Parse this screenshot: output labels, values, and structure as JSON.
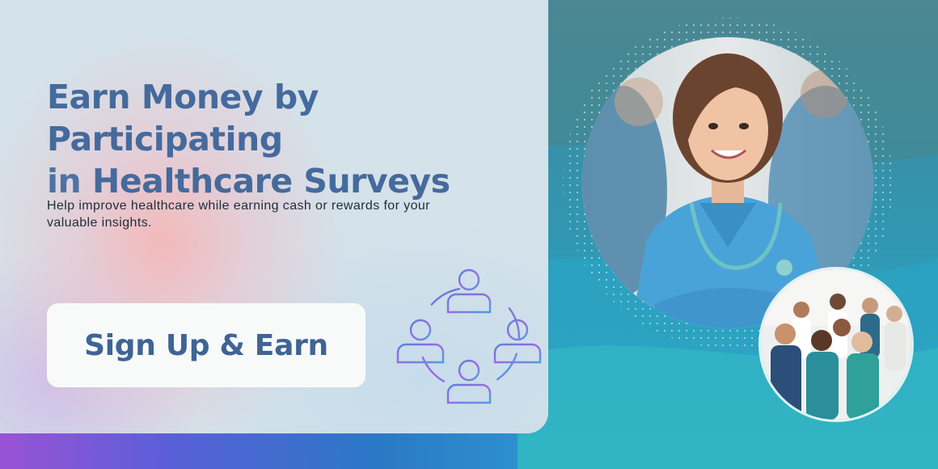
{
  "headline": {
    "line1": "Earn Money by Participating",
    "line2_prefix": "in ",
    "line2_bold": "Healthcare Surveys"
  },
  "subtext": "Help improve healthcare while earning cash or rewards for your valuable insights.",
  "cta": {
    "label": "Sign Up & Earn"
  },
  "icons": {
    "community": "community-network-icon"
  },
  "colors": {
    "headline": "#456a9c",
    "button_bg": "#f8fafa",
    "button_text": "#3f6494",
    "panel": "#d4e2ea",
    "teal": "#3f8b98"
  }
}
